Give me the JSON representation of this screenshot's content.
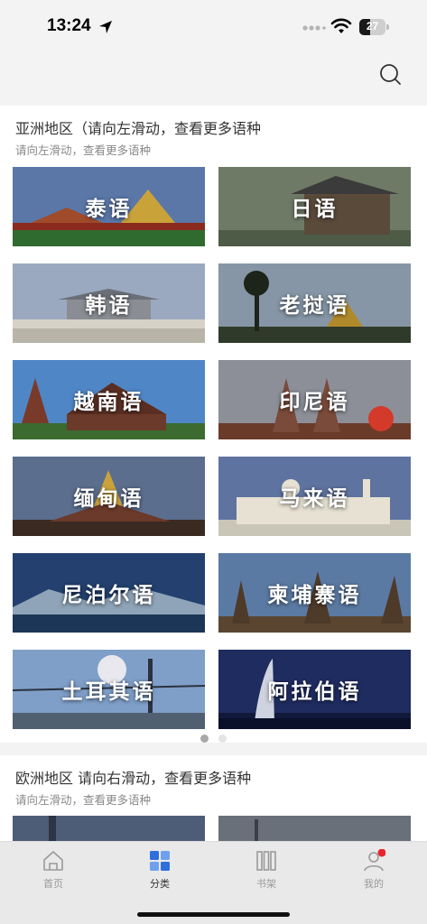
{
  "status_bar": {
    "time": "13:24",
    "battery": "27"
  },
  "header": {
    "search_icon": "search-icon"
  },
  "sections": [
    {
      "title": "亚洲地区（请向左滑动，查看更多语种",
      "subtitle": "请向左滑动，查看更多语种",
      "languages": [
        "泰语",
        "日语",
        "韩语",
        "老挝语",
        "越南语",
        "印尼语",
        "缅甸语",
        "马来语",
        "尼泊尔语",
        "柬埔寨语",
        "土耳其语",
        "阿拉伯语"
      ]
    },
    {
      "title": "欧洲地区 请向右滑动，查看更多语种",
      "subtitle": "请向左滑动，查看更多语种"
    }
  ],
  "pager": {
    "pages": 2,
    "current": 1
  },
  "tabbar": {
    "tabs": [
      {
        "label": "首页",
        "icon": "home-icon"
      },
      {
        "label": "分类",
        "icon": "category-icon"
      },
      {
        "label": "书架",
        "icon": "bookshelf-icon"
      },
      {
        "label": "我的",
        "icon": "profile-icon"
      }
    ],
    "active": 1
  },
  "colors": {
    "accent": "#3a7be8",
    "badge": "#e8262e"
  }
}
